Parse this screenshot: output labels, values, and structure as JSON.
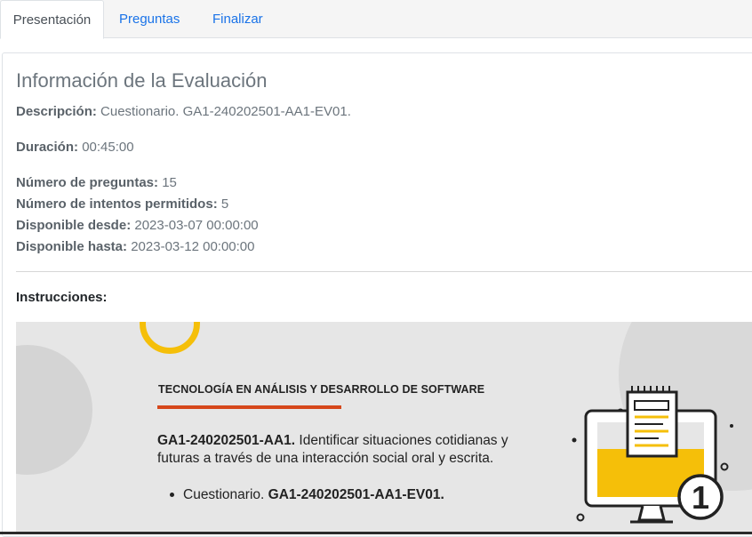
{
  "tabs": [
    {
      "label": "Presentación",
      "active": true
    },
    {
      "label": "Preguntas",
      "active": false
    },
    {
      "label": "Finalizar",
      "active": false
    }
  ],
  "info": {
    "title": "Información de la Evaluación",
    "description_label": "Descripción:",
    "description_value": "Cuestionario. GA1-240202501-AA1-EV01.",
    "duration_label": "Duración:",
    "duration_value": "00:45:00",
    "questions_label": "Número de preguntas:",
    "questions_value": "15",
    "attempts_label": "Número de intentos permitidos:",
    "attempts_value": "5",
    "from_label": "Disponible desde:",
    "from_value": "2023-03-07 00:00:00",
    "until_label": "Disponible hasta:",
    "until_value": "2023-03-12 00:00:00",
    "instructions_label": "Instrucciones:"
  },
  "banner": {
    "title": "TECNOLOGÍA EN ANÁLISIS Y DESARROLLO DE SOFTWARE",
    "code": "GA1-240202501-AA1.",
    "text": "Identificar situaciones cotidianas y futuras a través de una interacción social oral y escrita.",
    "bullet_prefix": "Cuestionario.",
    "bullet_code": "GA1-240202501-AA1-EV01.",
    "badge_number": "1"
  },
  "colors": {
    "accent_yellow": "#f5bf09",
    "accent_red": "#d6471b",
    "link_blue": "#1a73e8"
  }
}
